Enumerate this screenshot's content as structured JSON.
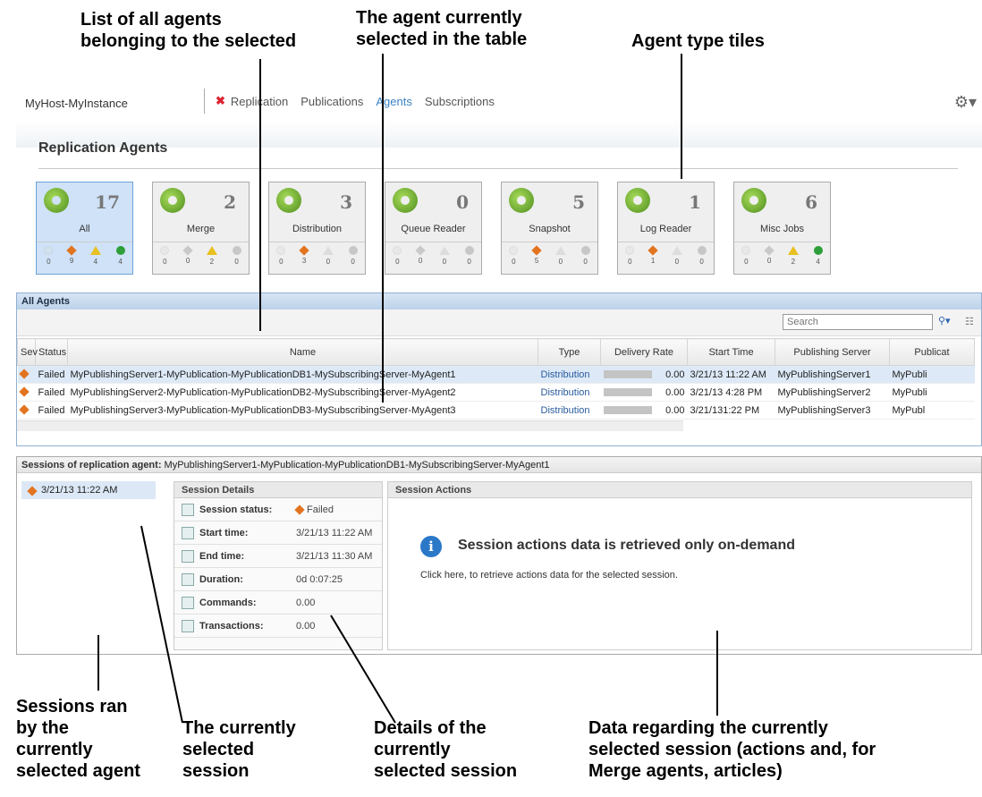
{
  "callouts": {
    "list": [
      "List of all agents",
      "belonging to the selected"
    ],
    "selected_agent": [
      "The agent currently",
      "selected in the table"
    ],
    "tiles": [
      "Agent type tiles"
    ],
    "sessions_ran": [
      "Sessions ran",
      "by the",
      "currently",
      "selected agent"
    ],
    "current_session": [
      "The currently",
      "selected",
      "session"
    ],
    "details": [
      "Details of the",
      "currently",
      "selected session"
    ],
    "data": [
      "Data regarding the currently",
      "selected session (actions and, for",
      "Merge agents, articles)"
    ]
  },
  "header": {
    "host": "MyHost-MyInstance",
    "nav": [
      "Replication",
      "Publications",
      "Agents",
      "Subscriptions"
    ],
    "active_nav": "Agents",
    "page_title": "Replication Agents"
  },
  "tiles": [
    {
      "name": "All",
      "count": "17",
      "sev": [
        "0",
        "9",
        "4",
        "4"
      ]
    },
    {
      "name": "Merge",
      "count": "2",
      "sev": [
        "0",
        "0",
        "2",
        "0"
      ]
    },
    {
      "name": "Distribution",
      "count": "3",
      "sev": [
        "0",
        "3",
        "0",
        "0"
      ]
    },
    {
      "name": "Queue Reader",
      "count": "0",
      "sev": [
        "0",
        "0",
        "0",
        "0"
      ]
    },
    {
      "name": "Snapshot",
      "count": "5",
      "sev": [
        "0",
        "5",
        "0",
        "0"
      ]
    },
    {
      "name": "Log Reader",
      "count": "1",
      "sev": [
        "0",
        "1",
        "0",
        "0"
      ]
    },
    {
      "name": "Misc Jobs",
      "count": "6",
      "sev": [
        "0",
        "0",
        "2",
        "4"
      ]
    }
  ],
  "agents_panel": {
    "title": "All Agents",
    "search_placeholder": "Search",
    "columns": [
      "Sev",
      "Status",
      "Name",
      "Type",
      "Delivery Rate",
      "Start Time",
      "Publishing Server",
      "Publicat"
    ],
    "rows": [
      {
        "status": "Failed",
        "name": "MyPublishingServer1-MyPublication-MyPublicationDB1-MySubscribingServer-MyAgent1",
        "type": "Distribution",
        "rate": "0.00",
        "start": "3/21/13 11:22 AM",
        "server": "MyPublishingServer1",
        "pub": "MyPubli"
      },
      {
        "status": "Failed",
        "name": "MyPublishingServer2-MyPublication-MyPublicationDB2-MySubscribingServer-MyAgent2",
        "type": "Distribution",
        "rate": "0.00",
        "start": "3/21/13 4:28 PM",
        "server": "MyPublishingServer2",
        "pub": "MyPubli"
      },
      {
        "status": "Failed",
        "name": "MyPublishingServer3-MyPublication-MyPublicationDB3-MySubscribingServer-MyAgent3",
        "type": "Distribution",
        "rate": "0.00",
        "start": "3/21/131:22 PM",
        "server": "MyPublishingServer3",
        "pub": "MyPubl"
      }
    ]
  },
  "sessions_panel": {
    "label": "Sessions of replication agent:",
    "agent": "MyPublishingServer1-MyPublication-MyPublicationDB1-MySubscribingServer-MyAgent1",
    "session": "3/21/13 11:22 AM",
    "details_title": "Session Details",
    "details": [
      {
        "label": "Session status:",
        "value": "Failed"
      },
      {
        "label": "Start time:",
        "value": "3/21/13 11:22 AM"
      },
      {
        "label": "End time:",
        "value": "3/21/13 11:30 AM"
      },
      {
        "label": "Duration:",
        "value": "0d 0:07:25"
      },
      {
        "label": "Commands:",
        "value": "0.00"
      },
      {
        "label": "Transactions:",
        "value": "0.00"
      }
    ],
    "actions_title": "Session Actions",
    "actions_message": "Session actions data is retrieved only on-demand",
    "actions_link": "Click here, to retrieve actions data for the selected session."
  }
}
